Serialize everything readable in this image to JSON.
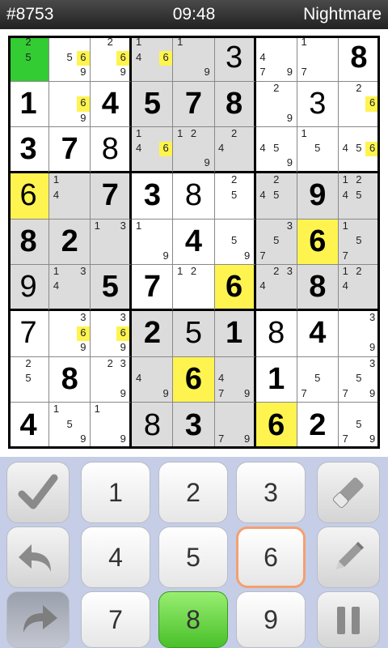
{
  "status": {
    "puzzle_id": "#8753",
    "clock": "09:48",
    "difficulty": "Nightmare"
  },
  "colors": {
    "selected": "#33cc33",
    "highlight": "#fff44f",
    "shade": "#dcdcdc",
    "current_key_border": "#f4a070",
    "active_key": "#49c02a"
  },
  "board": {
    "cells": [
      [
        {
          "notes": [
            2,
            5
          ],
          "sel": 1
        },
        {
          "notes": [
            5,
            6,
            9
          ],
          "hl": [
            6
          ]
        },
        {
          "notes": [
            2,
            6,
            9
          ],
          "hl": [
            6
          ]
        },
        {
          "notes": [
            1,
            4,
            6
          ],
          "hl": [
            6
          ]
        },
        {
          "notes": [
            1,
            9
          ]
        },
        {
          "v": "3"
        },
        {
          "notes": [
            4,
            7,
            9
          ]
        },
        {
          "notes": [
            1,
            7
          ]
        },
        {
          "v": "8",
          "g": 1
        }
      ],
      [
        {
          "v": "1",
          "g": 1
        },
        {
          "notes": [
            6,
            9
          ],
          "hl": [
            6
          ]
        },
        {
          "v": "4",
          "g": 1
        },
        {
          "v": "5",
          "g": 1
        },
        {
          "v": "7",
          "g": 1
        },
        {
          "v": "8",
          "g": 1
        },
        {
          "notes": [
            2,
            9
          ]
        },
        {
          "v": "3"
        },
        {
          "notes": [
            2,
            6
          ],
          "hl": [
            6
          ]
        }
      ],
      [
        {
          "v": "3",
          "g": 1
        },
        {
          "v": "7",
          "g": 1
        },
        {
          "v": "8"
        },
        {
          "notes": [
            1,
            4,
            6
          ],
          "hl": [
            6
          ]
        },
        {
          "notes": [
            1,
            2,
            9
          ]
        },
        {
          "notes": [
            2,
            4
          ]
        },
        {
          "notes": [
            4,
            5,
            9
          ]
        },
        {
          "notes": [
            1,
            5
          ]
        },
        {
          "notes": [
            4,
            5,
            6
          ],
          "hl": [
            6
          ]
        }
      ],
      [
        {
          "v": "6",
          "hlc": 1
        },
        {
          "notes": [
            1,
            4
          ]
        },
        {
          "v": "7",
          "g": 1
        },
        {
          "v": "3",
          "g": 1
        },
        {
          "v": "8"
        },
        {
          "notes": [
            2,
            5
          ]
        },
        {
          "notes": [
            2,
            4,
            5
          ]
        },
        {
          "v": "9",
          "g": 1
        },
        {
          "notes": [
            1,
            2,
            4,
            5
          ]
        }
      ],
      [
        {
          "v": "8",
          "g": 1
        },
        {
          "v": "2",
          "g": 1
        },
        {
          "notes": [
            1,
            3
          ]
        },
        {
          "notes": [
            1,
            9
          ]
        },
        {
          "v": "4",
          "g": 1
        },
        {
          "notes": [
            5,
            9
          ]
        },
        {
          "notes": [
            3,
            5,
            7
          ]
        },
        {
          "v": "6",
          "g": 1,
          "hlc": 1
        },
        {
          "notes": [
            1,
            5,
            7
          ]
        }
      ],
      [
        {
          "v": "9"
        },
        {
          "notes": [
            1,
            3,
            4
          ]
        },
        {
          "v": "5",
          "g": 1
        },
        {
          "v": "7",
          "g": 1
        },
        {
          "notes": [
            1,
            2
          ]
        },
        {
          "v": "6",
          "g": 1,
          "hlc": 1
        },
        {
          "notes": [
            2,
            3,
            4
          ]
        },
        {
          "v": "8",
          "g": 1
        },
        {
          "notes": [
            1,
            2,
            4
          ]
        }
      ],
      [
        {
          "v": "7"
        },
        {
          "notes": [
            3,
            6,
            9
          ],
          "hl": [
            6
          ]
        },
        {
          "notes": [
            3,
            6,
            9
          ],
          "hl": [
            6
          ]
        },
        {
          "v": "2",
          "g": 1
        },
        {
          "v": "5"
        },
        {
          "v": "1",
          "g": 1
        },
        {
          "v": "8"
        },
        {
          "v": "4",
          "g": 1
        },
        {
          "notes": [
            3,
            9
          ]
        }
      ],
      [
        {
          "notes": [
            2,
            5
          ]
        },
        {
          "v": "8",
          "g": 1
        },
        {
          "notes": [
            2,
            3,
            9
          ]
        },
        {
          "notes": [
            4,
            9
          ]
        },
        {
          "v": "6",
          "g": 1,
          "hlc": 1
        },
        {
          "notes": [
            4,
            7,
            9
          ]
        },
        {
          "v": "1",
          "g": 1
        },
        {
          "notes": [
            5,
            7
          ]
        },
        {
          "notes": [
            3,
            5,
            7,
            9
          ]
        }
      ],
      [
        {
          "v": "4",
          "g": 1
        },
        {
          "notes": [
            1,
            5,
            9
          ]
        },
        {
          "notes": [
            1,
            9
          ]
        },
        {
          "v": "8"
        },
        {
          "v": "3",
          "g": 1
        },
        {
          "notes": [
            7,
            9
          ]
        },
        {
          "v": "6",
          "g": 1,
          "hlc": 1
        },
        {
          "v": "2",
          "g": 1
        },
        {
          "notes": [
            5,
            7,
            9
          ]
        }
      ]
    ]
  },
  "keypad": {
    "digits": [
      "1",
      "2",
      "3",
      "4",
      "5",
      "6",
      "7",
      "8",
      "9"
    ],
    "current_digit": "6",
    "active_digit": "8",
    "tools": [
      "check-icon",
      "eraser-icon",
      "undo-icon",
      "pencil-icon",
      "redo-icon",
      "pause-icon"
    ]
  }
}
